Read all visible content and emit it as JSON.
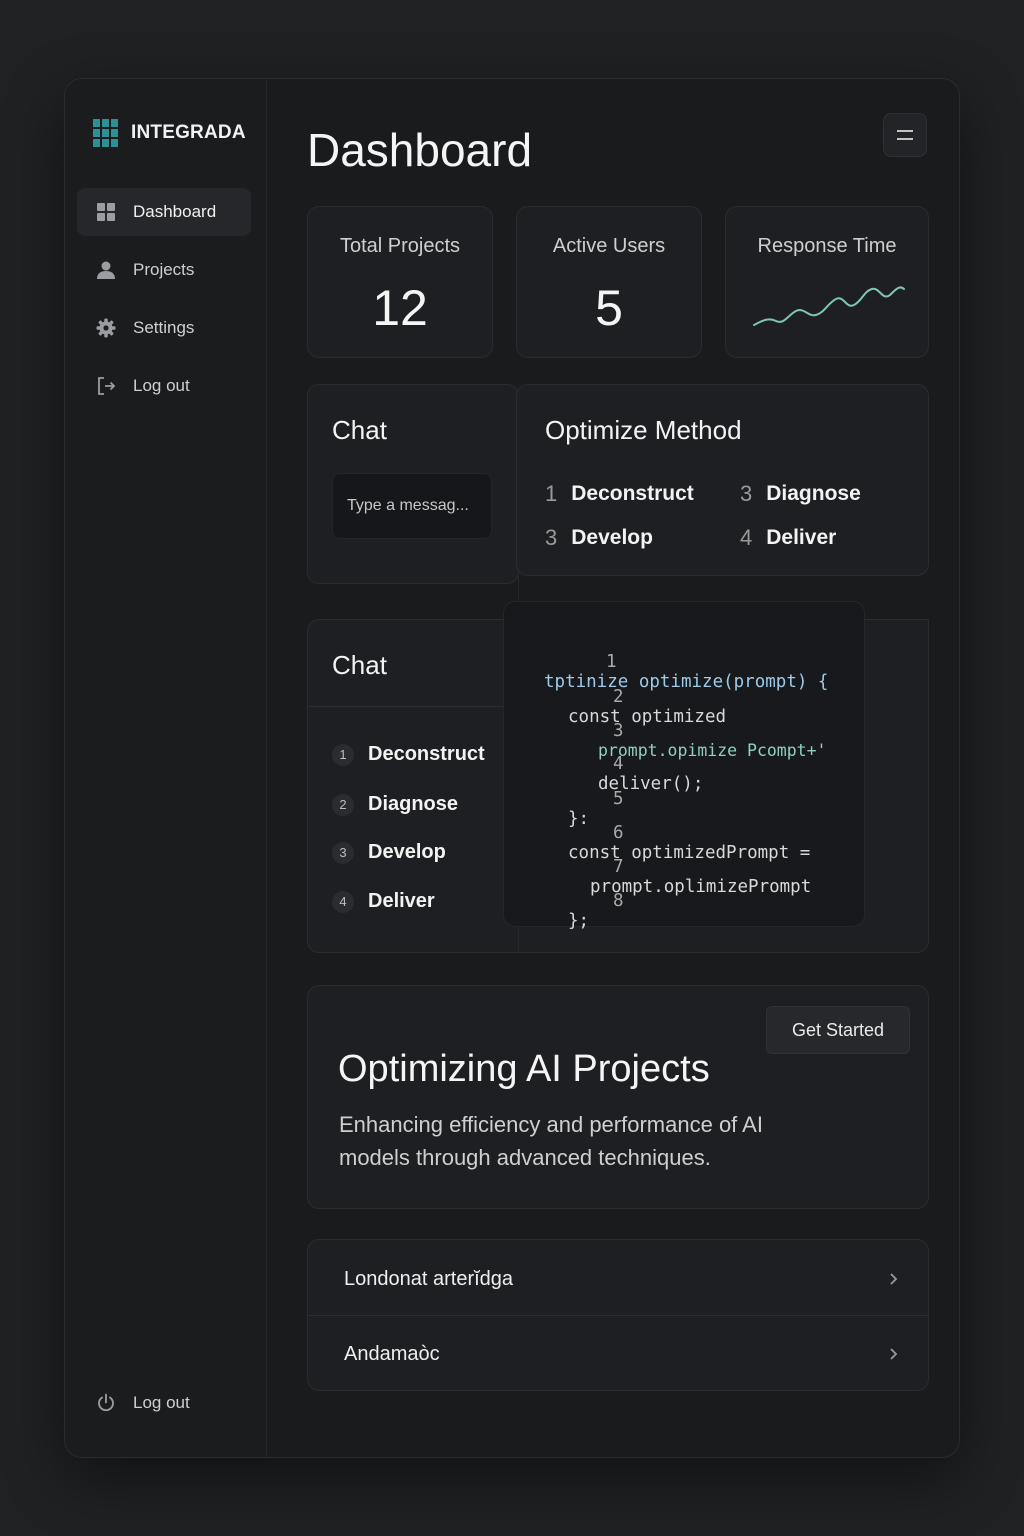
{
  "brand": {
    "name": "INTEGRADA",
    "accent": "#2e8f95"
  },
  "sidebar": {
    "items": [
      {
        "label": "Dashboard",
        "icon": "grid-icon",
        "active": true
      },
      {
        "label": "Projects",
        "icon": "user-icon"
      },
      {
        "label": "Settings",
        "icon": "gear-icon"
      },
      {
        "label": "Log out",
        "icon": "logout-icon"
      }
    ],
    "footer": {
      "label": "Log out",
      "icon": "power-icon"
    }
  },
  "header": {
    "title": "Dashboard",
    "menu_icon": "menu-icon"
  },
  "stats": [
    {
      "label": "Total Projects",
      "value": "12"
    },
    {
      "label": "Active Users",
      "value": "5"
    },
    {
      "label": "Response Time",
      "sparkline_color": "#7fc6b6"
    }
  ],
  "chat_small": {
    "title": "Chat",
    "placeholder": "Type a messag..."
  },
  "optimize": {
    "title": "Optimize Method",
    "items": [
      {
        "num": "1",
        "label": "Deconstruct"
      },
      {
        "num": "3",
        "label": "Diagnose"
      },
      {
        "num": "3",
        "label": "Develop"
      },
      {
        "num": "4",
        "label": "Deliver"
      }
    ]
  },
  "chat_steps": {
    "title": "Chat",
    "steps": [
      {
        "num": "1",
        "label": "Deconstruct"
      },
      {
        "num": "2",
        "label": "Diagnose"
      },
      {
        "num": "3",
        "label": "Develop"
      },
      {
        "num": "4",
        "label": "Deliver"
      }
    ]
  },
  "code": {
    "lines": [
      {
        "n": "1",
        "text": "tptinize optimize(prompt) {"
      },
      {
        "n": "2",
        "text": "const optimized"
      },
      {
        "n": "3",
        "text": "prompt.opimize Pcompt+'"
      },
      {
        "n": "4",
        "text": "deliver();"
      },
      {
        "n": "5",
        "text": "}:"
      },
      {
        "n": "6",
        "text": "const optimizedPrompt ="
      },
      {
        "n": "7",
        "text": "prompt.oplimizePrompt"
      },
      {
        "n": "8",
        "text": "};"
      }
    ]
  },
  "hero": {
    "title": "Optimizing AI Projects",
    "description": "Enhancing efficiency and performance of AI models through advanced techniques.",
    "cta": "Get Started"
  },
  "list": [
    {
      "label": "Londonat arterĭdga"
    },
    {
      "label": "Andamaòc"
    }
  ]
}
